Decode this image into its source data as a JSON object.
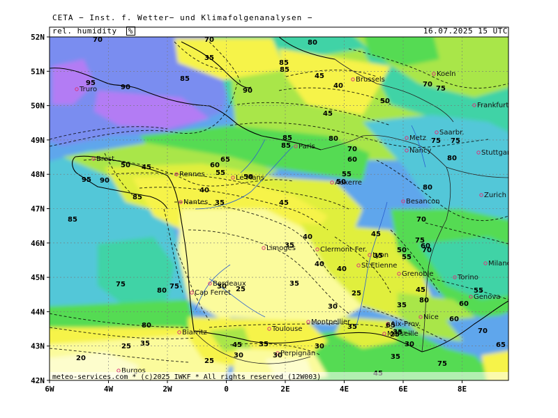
{
  "header": {
    "title": "CETA − Inst. f. Wetter− und Klimafolgenanalysen −"
  },
  "panel": {
    "variable_label": "rel. humidity",
    "unit_label": "%",
    "valid_time": "16.07.2025 15 UTC"
  },
  "footer": {
    "copyright": "meteo-services.com * (c)2025 IWKF * All rights reserved (12W003)"
  },
  "axes": {
    "lat_labels": [
      "52N",
      "51N",
      "50N",
      "49N",
      "48N",
      "47N",
      "46N",
      "45N",
      "44N",
      "43N",
      "42N"
    ],
    "lon_labels": [
      "6W",
      "4W",
      "2W",
      "0",
      "2E",
      "4E",
      "6E",
      "8E"
    ]
  },
  "cities": [
    {
      "name": "Truro"
    },
    {
      "name": "Brussels"
    },
    {
      "name": "Koeln"
    },
    {
      "name": "Frankfurt"
    },
    {
      "name": "Metz"
    },
    {
      "name": "Saarbr."
    },
    {
      "name": "Nancy"
    },
    {
      "name": "Stuttgart"
    },
    {
      "name": "Brest"
    },
    {
      "name": "Rennes"
    },
    {
      "name": "Le Mans"
    },
    {
      "name": "Paris"
    },
    {
      "name": "Auxerre"
    },
    {
      "name": "Nantes"
    },
    {
      "name": "Besancon"
    },
    {
      "name": "Zurich"
    },
    {
      "name": "Limoges"
    },
    {
      "name": "Clermont-Fer."
    },
    {
      "name": "Lyon"
    },
    {
      "name": "St.Etienne"
    },
    {
      "name": "Grenoble"
    },
    {
      "name": "Torino"
    },
    {
      "name": "Milano"
    },
    {
      "name": "Bordeaux"
    },
    {
      "name": "Cap Ferret"
    },
    {
      "name": "Genova"
    },
    {
      "name": "Nice"
    },
    {
      "name": "Aix-Prov."
    },
    {
      "name": "Montpellier"
    },
    {
      "name": "Marseille"
    },
    {
      "name": "Toulouse"
    },
    {
      "name": "Biarritz"
    },
    {
      "name": "Perpignan"
    },
    {
      "name": "Burgos"
    }
  ],
  "isolines": [
    {
      "v": "70"
    },
    {
      "v": "70"
    },
    {
      "v": "35"
    },
    {
      "v": "80"
    },
    {
      "v": "95"
    },
    {
      "v": "90"
    },
    {
      "v": "85"
    },
    {
      "v": "90"
    },
    {
      "v": "45"
    },
    {
      "v": "40"
    },
    {
      "v": "85"
    },
    {
      "v": "85"
    },
    {
      "v": "50"
    },
    {
      "v": "70"
    },
    {
      "v": "75"
    },
    {
      "v": "45"
    },
    {
      "v": "85"
    },
    {
      "v": "80"
    },
    {
      "v": "85"
    },
    {
      "v": "75"
    },
    {
      "v": "80"
    },
    {
      "v": "75"
    },
    {
      "v": "70"
    },
    {
      "v": "65"
    },
    {
      "v": "60"
    },
    {
      "v": "50"
    },
    {
      "v": "45"
    },
    {
      "v": "55"
    },
    {
      "v": "50"
    },
    {
      "v": "95"
    },
    {
      "v": "90"
    },
    {
      "v": "85"
    },
    {
      "v": "40"
    },
    {
      "v": "35"
    },
    {
      "v": "45"
    },
    {
      "v": "55"
    },
    {
      "v": "50"
    },
    {
      "v": "60"
    },
    {
      "v": "85"
    },
    {
      "v": "70"
    },
    {
      "v": "75"
    },
    {
      "v": "70"
    },
    {
      "v": "80"
    },
    {
      "v": "35"
    },
    {
      "v": "40"
    },
    {
      "v": "45"
    },
    {
      "v": "35"
    },
    {
      "v": "40"
    },
    {
      "v": "50"
    },
    {
      "v": "55"
    },
    {
      "v": "60"
    },
    {
      "v": "75"
    },
    {
      "v": "80"
    },
    {
      "v": "75"
    },
    {
      "v": "80"
    },
    {
      "v": "30"
    },
    {
      "v": "25"
    },
    {
      "v": "35"
    },
    {
      "v": "40"
    },
    {
      "v": "25"
    },
    {
      "v": "30"
    },
    {
      "v": "35"
    },
    {
      "v": "45"
    },
    {
      "v": "55"
    },
    {
      "v": "30"
    },
    {
      "v": "35"
    },
    {
      "v": "65"
    },
    {
      "v": "80"
    },
    {
      "v": "25"
    },
    {
      "v": "35"
    },
    {
      "v": "45"
    },
    {
      "v": "20"
    },
    {
      "v": "25"
    },
    {
      "v": "30"
    },
    {
      "v": "35"
    },
    {
      "v": "25"
    },
    {
      "v": "30"
    },
    {
      "v": "35"
    },
    {
      "v": "45"
    },
    {
      "v": "60"
    },
    {
      "v": "70"
    },
    {
      "v": "60"
    },
    {
      "v": "75"
    },
    {
      "v": "65"
    },
    {
      "v": "35"
    },
    {
      "v": "30"
    }
  ],
  "colors": {
    "h20": "#fdfdcc",
    "h30": "#fbfb9c",
    "h40": "#f6f34a",
    "h50": "#e0ef3c",
    "h60": "#a9e64a",
    "h70": "#55db52",
    "h75": "#3fd3a6",
    "h80": "#53c7d8",
    "h85": "#5fa6ec",
    "h90": "#7a8df0",
    "h95": "#b37cf4",
    "city_marker": "#d8337a",
    "border": "#000000"
  }
}
